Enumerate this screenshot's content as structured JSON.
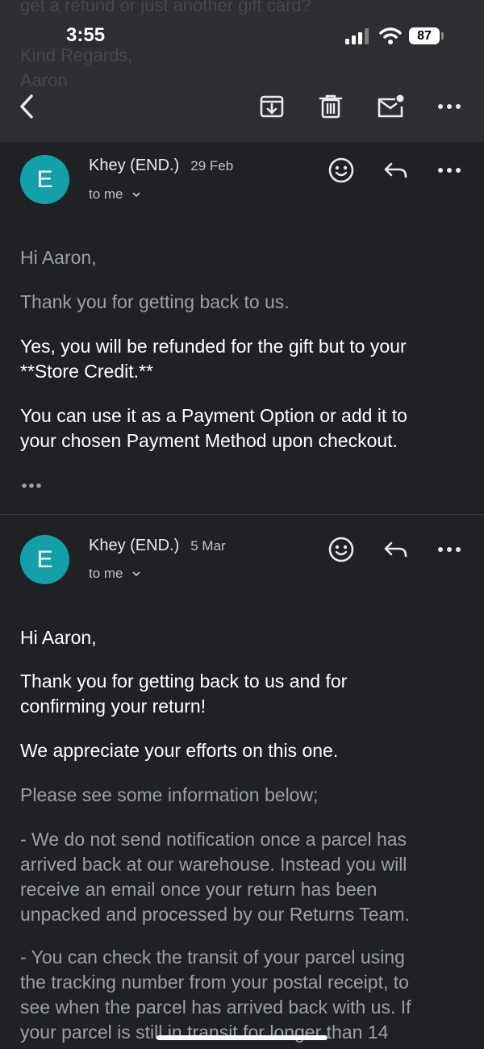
{
  "status_bar": {
    "time": "3:55",
    "battery": "87"
  },
  "background_quote": [
    "get a refund or just another gift card?",
    "Kind Regards,",
    "Aaron"
  ],
  "toolbar": {
    "back_icon": "chevron-left-icon",
    "archive_icon": "archive-icon",
    "delete_icon": "trash-icon",
    "mark_unread_icon": "mail-unread-icon",
    "more_icon": "more-horizontal-icon"
  },
  "messages": [
    {
      "avatar_letter": "E",
      "sender": "Khey (END.)",
      "date": "29 Feb",
      "recipient": "to me",
      "paragraphs": [
        "Hi Aaron,",
        "Thank you for getting back to us.",
        "Yes, you will be refunded for the gift but to your\n**Store Credit.**",
        "You can use it as a Payment Option or add it to\nyour chosen Payment Method upon checkout."
      ],
      "quoted_toggle": "•••"
    },
    {
      "avatar_letter": "E",
      "sender": "Khey (END.)",
      "date": "5 Mar",
      "recipient": "to me",
      "paragraphs": [
        "Hi Aaron,",
        "Thank you for getting back to us and for\nconfirming your return!",
        "We appreciate your efforts on this one.",
        "Please see some information below;",
        "- We do not send notification once a parcel has\narrived back at our warehouse. Instead you will\nreceive an email once your return has been\nunpacked and processed by our Returns Team.",
        "- You can check the transit of your parcel using\nthe tracking number from your postal receipt, to\nsee when the parcel has arrived back with us. If\nyour parcel is still in transit for longer than 14"
      ]
    }
  ],
  "colors": {
    "avatar": "#14a0a8",
    "background": "#202124",
    "toolbar": "#2d2e31"
  }
}
